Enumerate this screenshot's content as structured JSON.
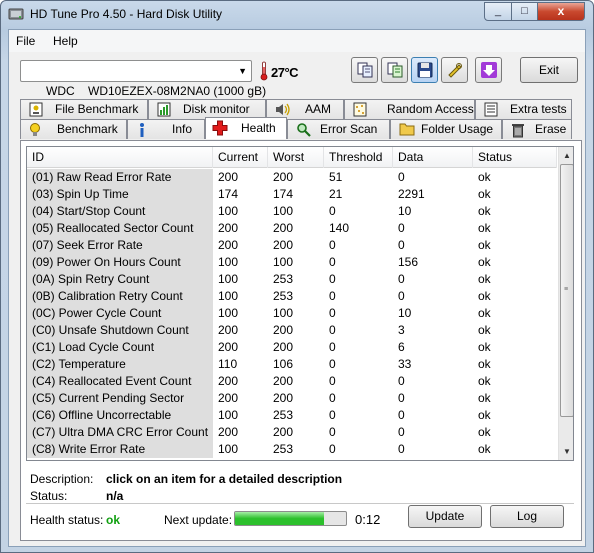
{
  "window": {
    "title": "HD Tune Pro 4.50 - Hard Disk Utility",
    "close_glyph": "x",
    "min_glyph": "_",
    "max_glyph": "□"
  },
  "menu": {
    "file": "File",
    "help": "Help"
  },
  "toolbar": {
    "drive": "WDC    WD10EZEX-08M2NA0 (1000 gB)",
    "temperature": "27°C",
    "exit": "Exit"
  },
  "tabs_top": [
    "File Benchmark",
    "Disk monitor",
    "AAM",
    "Random Access",
    "Extra tests"
  ],
  "tabs_bottom": [
    "Benchmark",
    "Info",
    "Health",
    "Error Scan",
    "Folder Usage",
    "Erase"
  ],
  "active_tab": "Health",
  "table": {
    "headers": [
      "ID",
      "Current",
      "Worst",
      "Threshold",
      "Data",
      "Status"
    ],
    "rows": [
      [
        "(01) Raw Read Error Rate",
        "200",
        "200",
        "51",
        "0",
        "ok"
      ],
      [
        "(03) Spin Up Time",
        "174",
        "174",
        "21",
        "2291",
        "ok"
      ],
      [
        "(04) Start/Stop Count",
        "100",
        "100",
        "0",
        "10",
        "ok"
      ],
      [
        "(05) Reallocated Sector Count",
        "200",
        "200",
        "140",
        "0",
        "ok"
      ],
      [
        "(07) Seek Error Rate",
        "200",
        "200",
        "0",
        "0",
        "ok"
      ],
      [
        "(09) Power On Hours Count",
        "100",
        "100",
        "0",
        "156",
        "ok"
      ],
      [
        "(0A) Spin Retry Count",
        "100",
        "253",
        "0",
        "0",
        "ok"
      ],
      [
        "(0B) Calibration Retry Count",
        "100",
        "253",
        "0",
        "0",
        "ok"
      ],
      [
        "(0C) Power Cycle Count",
        "100",
        "100",
        "0",
        "10",
        "ok"
      ],
      [
        "(C0) Unsafe Shutdown Count",
        "200",
        "200",
        "0",
        "3",
        "ok"
      ],
      [
        "(C1) Load Cycle Count",
        "200",
        "200",
        "0",
        "6",
        "ok"
      ],
      [
        "(C2) Temperature",
        "110",
        "106",
        "0",
        "33",
        "ok"
      ],
      [
        "(C4) Reallocated Event Count",
        "200",
        "200",
        "0",
        "0",
        "ok"
      ],
      [
        "(C5) Current Pending Sector",
        "200",
        "200",
        "0",
        "0",
        "ok"
      ],
      [
        "(C6) Offline Uncorrectable",
        "100",
        "253",
        "0",
        "0",
        "ok"
      ],
      [
        "(C7) Ultra DMA CRC Error Count",
        "200",
        "200",
        "0",
        "0",
        "ok"
      ],
      [
        "(C8) Write Error Rate",
        "100",
        "253",
        "0",
        "0",
        "ok"
      ]
    ]
  },
  "details": {
    "description_label": "Description:",
    "description_value": "click on an item for a detailed description",
    "status_label": "Status:",
    "status_value": "n/a"
  },
  "footer": {
    "health_label": "Health status:",
    "health_value": "ok",
    "next_update_label": "Next update:",
    "next_update_value": "0:12",
    "progress_fraction": 0.8,
    "update_button": "Update",
    "log_button": "Log"
  },
  "colors": {
    "health_ok": "#10a010",
    "progress_fill": "#2cc02c",
    "first_column_bg": "#dedede"
  }
}
